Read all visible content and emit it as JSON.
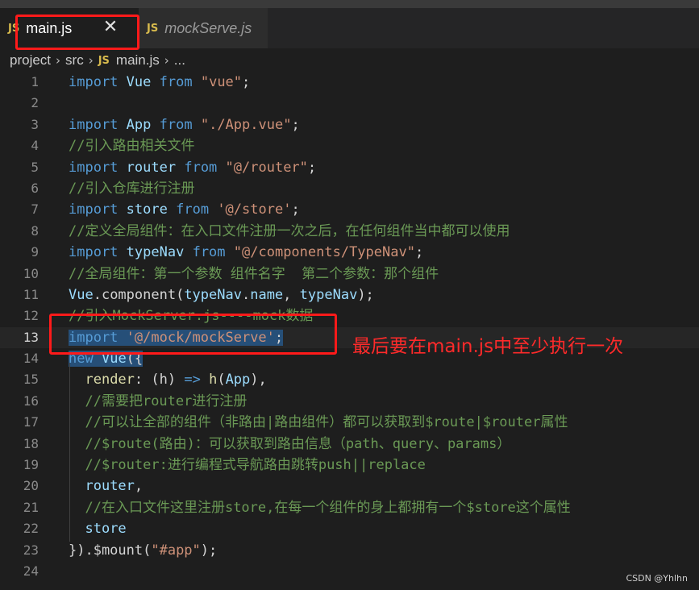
{
  "tabs": [
    {
      "badge": "JS",
      "name": "main.js",
      "close": "✕"
    },
    {
      "badge": "JS",
      "name": "mockServe.js"
    }
  ],
  "breadcrumb": {
    "parts": [
      "project",
      "src",
      "main.js",
      "..."
    ],
    "badge": "JS",
    "separator": "›"
  },
  "code_lines": [
    {
      "n": "1",
      "t": "import Vue from \"vue\";"
    },
    {
      "n": "2",
      "t": ""
    },
    {
      "n": "3",
      "t": "import App from \"./App.vue\";"
    },
    {
      "n": "4",
      "t": "//引入路由相关文件"
    },
    {
      "n": "5",
      "t": "import router from \"@/router\";"
    },
    {
      "n": "6",
      "t": "//引入仓库进行注册"
    },
    {
      "n": "7",
      "t": "import store from '@/store';"
    },
    {
      "n": "8",
      "t": "//定义全局组件：在入口文件注册一次之后，在任何组件当中都可以使用"
    },
    {
      "n": "9",
      "t": "import typeNav from \"@/components/TypeNav\";"
    },
    {
      "n": "10",
      "t": "//全局组件：第一个参数 组件名字  第二个参数：那个组件"
    },
    {
      "n": "11",
      "t": "Vue.component(typeNav.name, typeNav);"
    },
    {
      "n": "12",
      "t": "//引入MockServer.js----mock数据"
    },
    {
      "n": "13",
      "t": "import '@/mock/mockServe';"
    },
    {
      "n": "14",
      "t": "new Vue({"
    },
    {
      "n": "15",
      "t": "  render: (h) => h(App),"
    },
    {
      "n": "16",
      "t": "  //需要把router进行注册"
    },
    {
      "n": "17",
      "t": "  //可以让全部的组件（非路由|路由组件）都可以获取到$route|$router属性"
    },
    {
      "n": "18",
      "t": "  //$route(路由)：可以获取到路由信息（path、query、params）"
    },
    {
      "n": "19",
      "t": "  //$router:进行编程式导航路由跳转push||replace"
    },
    {
      "n": "20",
      "t": "  router,"
    },
    {
      "n": "21",
      "t": "  //在入口文件这里注册store,在每一个组件的身上都拥有一个$store这个属性"
    },
    {
      "n": "22",
      "t": "  store"
    },
    {
      "n": "23",
      "t": "}).$mount(\"#app\");"
    },
    {
      "n": "24",
      "t": ""
    }
  ],
  "annotation": "最后要在main.js中至少执行一次",
  "watermark": "CSDN @Yhlhn",
  "colors": {
    "highlight_box": "#ff1a1a",
    "selection": "#264f78",
    "keyword": "#569cd6",
    "string": "#ce9178",
    "comment": "#6a9955"
  }
}
